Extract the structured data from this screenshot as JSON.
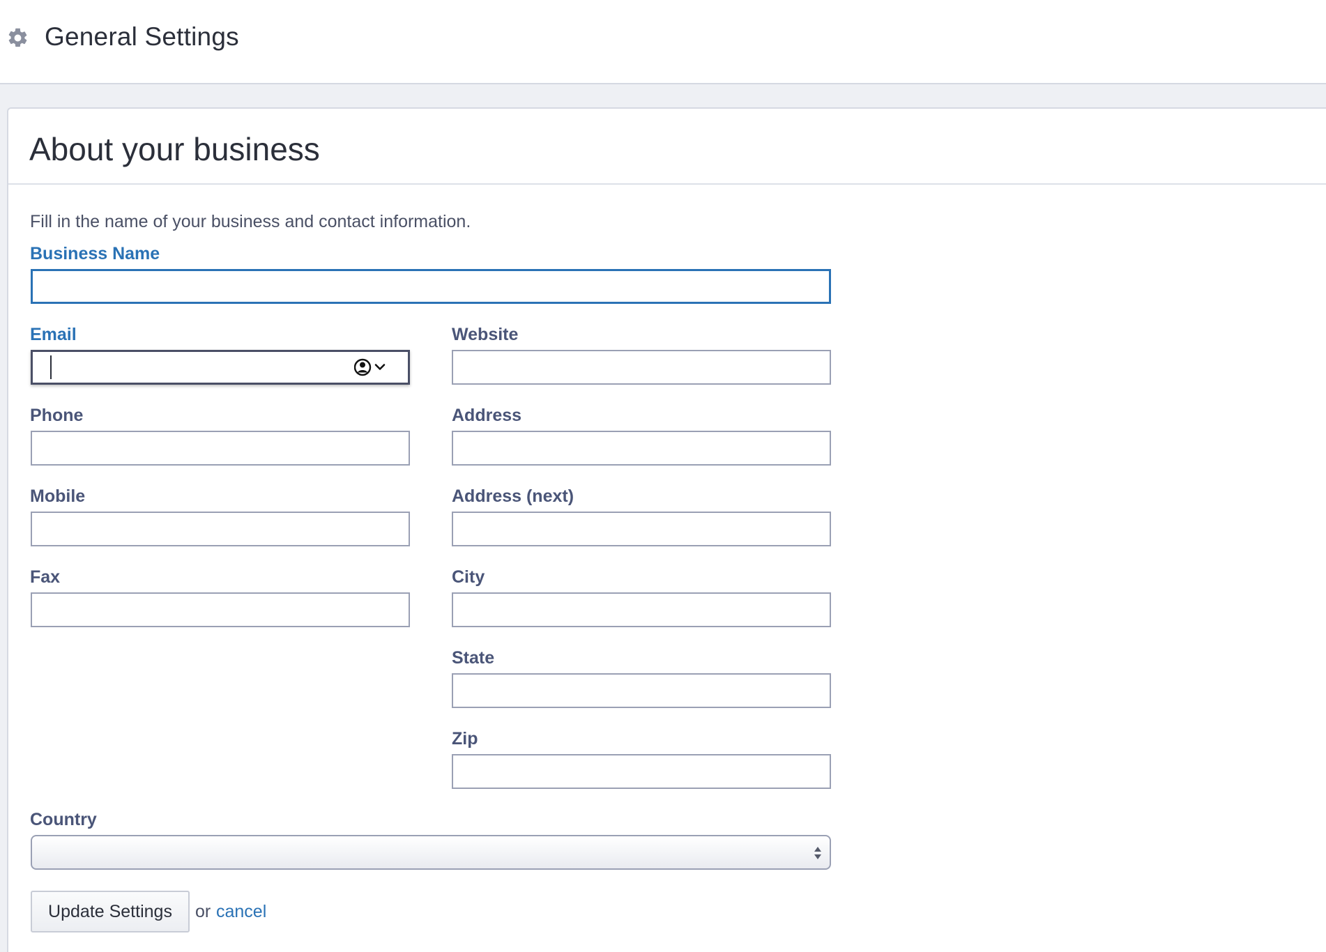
{
  "header": {
    "title": "General Settings",
    "icon": "gear-icon"
  },
  "section": {
    "title": "About your business",
    "intro": "Fill in the name of your business and contact information."
  },
  "form": {
    "business_name": {
      "label": "Business Name",
      "value": ""
    },
    "email": {
      "label": "Email",
      "value": "",
      "autofill_icon": "contact-autofill-icon"
    },
    "website": {
      "label": "Website",
      "value": ""
    },
    "phone": {
      "label": "Phone",
      "value": ""
    },
    "address": {
      "label": "Address",
      "value": ""
    },
    "mobile": {
      "label": "Mobile",
      "value": ""
    },
    "address_next": {
      "label": "Address (next)",
      "value": ""
    },
    "fax": {
      "label": "Fax",
      "value": ""
    },
    "city": {
      "label": "City",
      "value": ""
    },
    "state": {
      "label": "State",
      "value": ""
    },
    "zip": {
      "label": "Zip",
      "value": ""
    },
    "country": {
      "label": "Country",
      "selected": ""
    }
  },
  "actions": {
    "update_label": "Update Settings",
    "or_text": "or",
    "cancel_label": "cancel"
  },
  "colors": {
    "accent": "#2a72b5",
    "label": "#4a5578",
    "text": "#2b2f3a",
    "background": "#eef0f4"
  }
}
